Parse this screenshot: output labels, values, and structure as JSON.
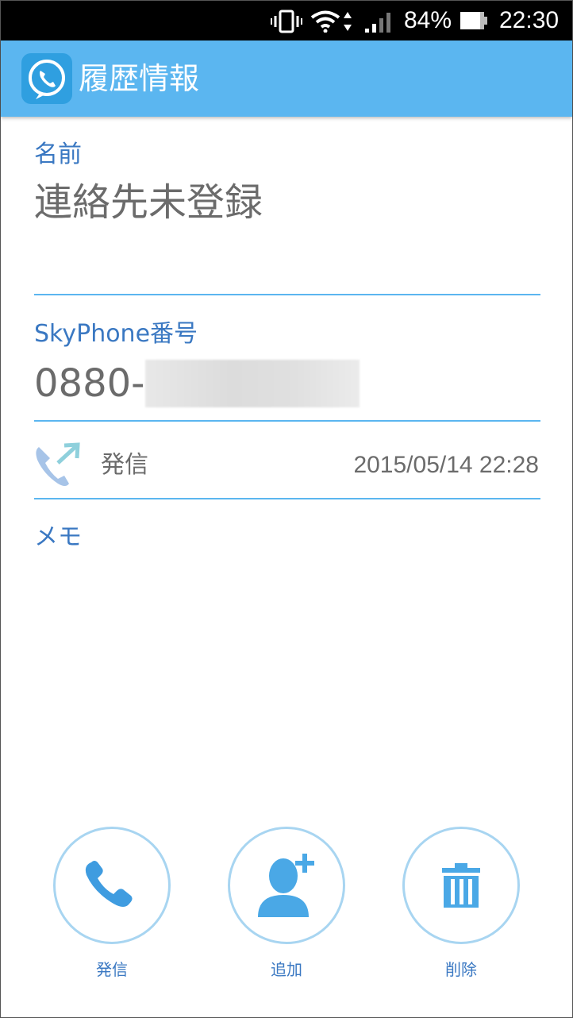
{
  "status_bar": {
    "battery_percent": "84%",
    "time": "22:30"
  },
  "app_bar": {
    "title": "履歴情報",
    "logo_icon": "phone-bubble-icon"
  },
  "detail": {
    "name_label": "名前",
    "name_value": "連絡先未登録",
    "number_label": "SkyPhone番号",
    "number_value": "0880-",
    "call_icon": "outgoing-call-icon",
    "call_type": "発信",
    "call_datetime": "2015/05/14 22:28",
    "memo_label": "メモ"
  },
  "actions": [
    {
      "label": "発信",
      "icon": "phone-icon"
    },
    {
      "label": "追加",
      "icon": "add-contact-icon"
    },
    {
      "label": "削除",
      "icon": "trash-icon"
    }
  ],
  "colors": {
    "accent": "#5bb6f0",
    "label_blue": "#3a78c2",
    "button_ring": "#a8d5f1"
  }
}
